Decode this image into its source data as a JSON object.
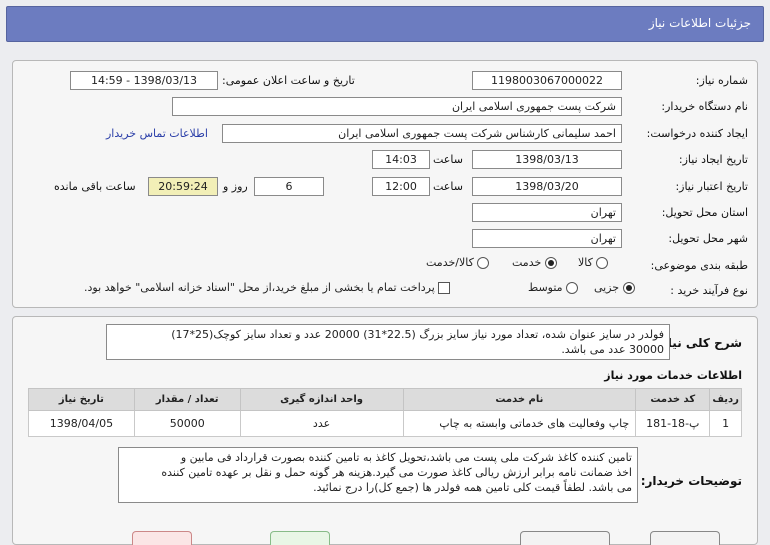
{
  "header": {
    "title": "جزئیات اطلاعات نیاز"
  },
  "form": {
    "need_number_label": "شماره نیاز:",
    "need_number": "1198003067000022",
    "announce_label": "تاریخ و ساعت اعلان عمومی:",
    "announce_value": "1398/03/13 - 14:59",
    "buyer_org_label": "نام دستگاه خریدار:",
    "buyer_org": "شرکت پست جمهوری اسلامی ایران",
    "requester_label": "ایجاد کننده درخواست:",
    "requester": "احمد سلیمانی کارشناس شرکت پست جمهوری اسلامی ایران",
    "contact_link": "اطلاعات تماس خریدار",
    "created_label": "تاریخ ایجاد نیاز:",
    "created_date": "1398/03/13",
    "time_label": "ساعت",
    "created_time": "14:03",
    "validity_label": "تاریخ اعتبار نیاز:",
    "validity_date": "1398/03/20",
    "validity_time": "12:00",
    "days_value": "6",
    "days_label": "روز و",
    "remaining_time": "20:59:24",
    "remaining_label": "ساعت باقی مانده",
    "province_label": "استان محل تحویل:",
    "province": "تهران",
    "city_label": "شهر محل تحویل:",
    "city": "تهران",
    "category_label": "طبقه بندی موضوعی:",
    "category_options": [
      "کالا",
      "خدمت",
      "کالا/خدمت"
    ],
    "process_label": "نوع فرآیند خرید :",
    "process_options": [
      "جزیی",
      "متوسط"
    ],
    "payment_text": "پرداخت تمام یا بخشی از مبلغ خرید،از محل \"اسناد خزانه اسلامی\" خواهد بود."
  },
  "description": {
    "label": "شرح کلی نیاز:",
    "line1": "فولدر در سایز عنوان شده، تعداد مورد نیاز سایز بزرگ (22.5*31) 20000 عدد و تعداد سایز کوچک(25*17)",
    "line2": "30000 عدد می باشد."
  },
  "services": {
    "title": "اطلاعات خدمات مورد نیاز",
    "columns": [
      "ردیف",
      "کد خدمت",
      "نام خدمت",
      "واحد اندازه گیری",
      "تعداد / مقدار",
      "تاریخ نیاز"
    ],
    "rows": [
      {
        "index": "1",
        "code": "پ-18-181",
        "name": "چاپ وفعالیت های خدماتی وابسته به چاپ",
        "unit": "عدد",
        "qty": "50000",
        "date": "1398/04/05"
      }
    ]
  },
  "buyer_notes": {
    "label": "توضیحات خریدار:",
    "line1": "تامین کننده کاغذ شرکت ملی پست می باشد،تحویل کاغذ به تامین کننده بصورت قرارداد فی مابین و",
    "line2": "اخذ ضمانت نامه برابر ارزش ریالی کاغذ  صورت می گیرد.هزینه هر گونه حمل و نقل بر عهده تامین کننده",
    "line3": "می باشد. لطفاً قیمت کلی تامین همه فولدر ها (جمع کل)را درج نمائید."
  }
}
